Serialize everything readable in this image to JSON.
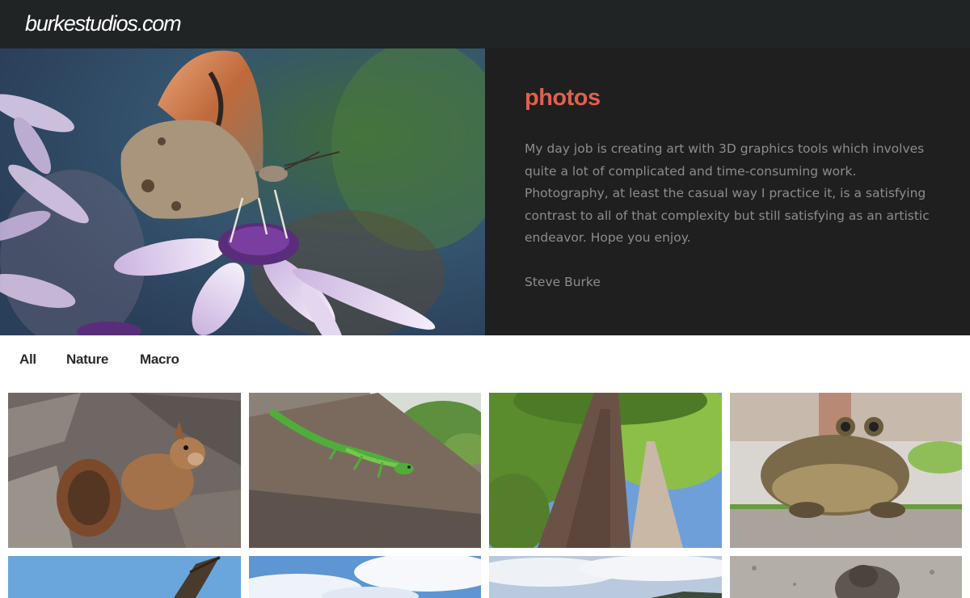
{
  "header": {
    "site_title": "burkestudios.com"
  },
  "hero": {
    "title": "photos",
    "intro": "My day job is creating art with 3D graphics tools which involves quite a lot of complicated and time-consuming work. Photography, at least the casual way I practice it, is a satisfying contrast to all of that complexity but still satisfying as an artistic endeavor. Hope you enjoy.",
    "signature": "Steve Burke",
    "accent_color": "#e0604e",
    "panel_color": "#1f1f1f"
  },
  "filters": [
    {
      "label": "All"
    },
    {
      "label": "Nature"
    },
    {
      "label": "Macro"
    }
  ],
  "gallery": [
    {
      "subject": "squirrel"
    },
    {
      "subject": "green gecko"
    },
    {
      "subject": "tall trees"
    },
    {
      "subject": "frog"
    },
    {
      "subject": "bird of prey in flight"
    },
    {
      "subject": "sky with clouds"
    },
    {
      "subject": "clouds over hills"
    },
    {
      "subject": "bird on stone"
    }
  ]
}
